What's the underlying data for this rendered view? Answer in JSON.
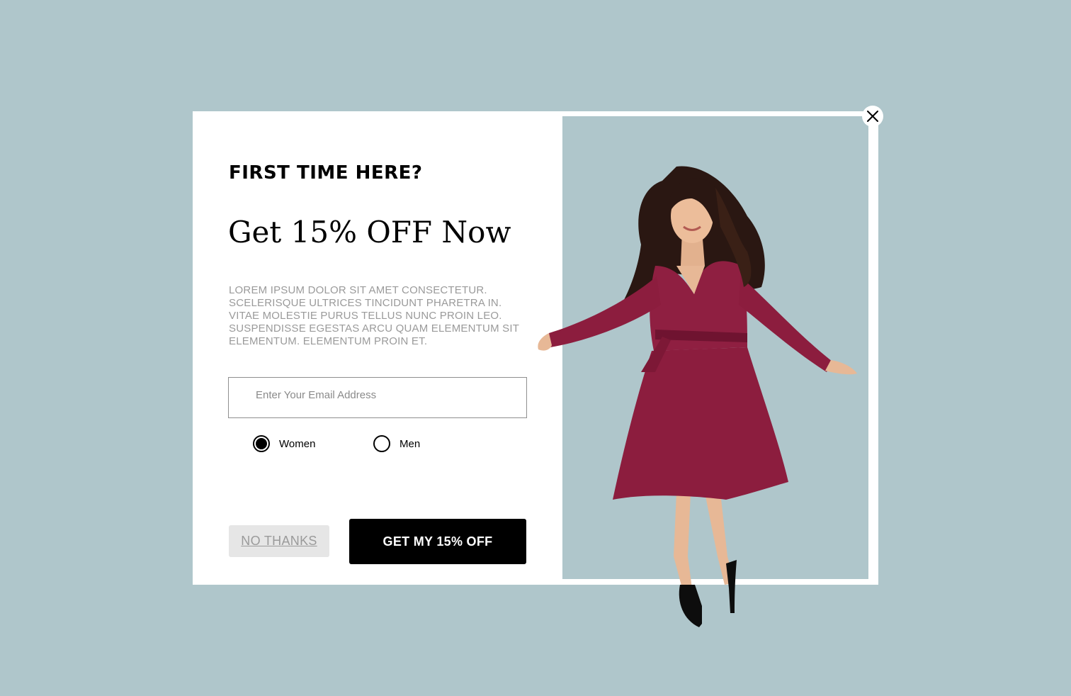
{
  "popup": {
    "eyebrow": "FIRST TIME HERE?",
    "headline": "Get 15% OFF Now",
    "body": "LOREM IPSUM DOLOR SIT AMET CONSECTETUR. SCELERISQUE ULTRICES TINCIDUNT PHARETRA IN. VITAE MOLESTIE PURUS TELLUS NUNC PROIN LEO. SUSPENDISSE EGESTAS ARCU QUAM ELEMENTUM SIT ELEMENTUM. ELEMENTUM PROIN ET.",
    "email_placeholder": "Enter Your Email Address",
    "email_value": "",
    "gender_options": [
      {
        "label": "Women",
        "selected": true
      },
      {
        "label": "Men",
        "selected": false
      }
    ],
    "decline_label": "NO THANKS",
    "cta_label": "GET MY 15% OFF"
  },
  "icons": {
    "close": "close-icon",
    "model": "model-photo"
  },
  "colors": {
    "page_background": "#afc6cb",
    "image_panel": "#afc6cb",
    "cta_background": "#000000",
    "cta_text": "#ffffff",
    "decline_background": "#e6e6e6",
    "decline_text": "#9a9a9a",
    "body_text": "#9a9a9a",
    "dress": "#8c1d3e"
  }
}
